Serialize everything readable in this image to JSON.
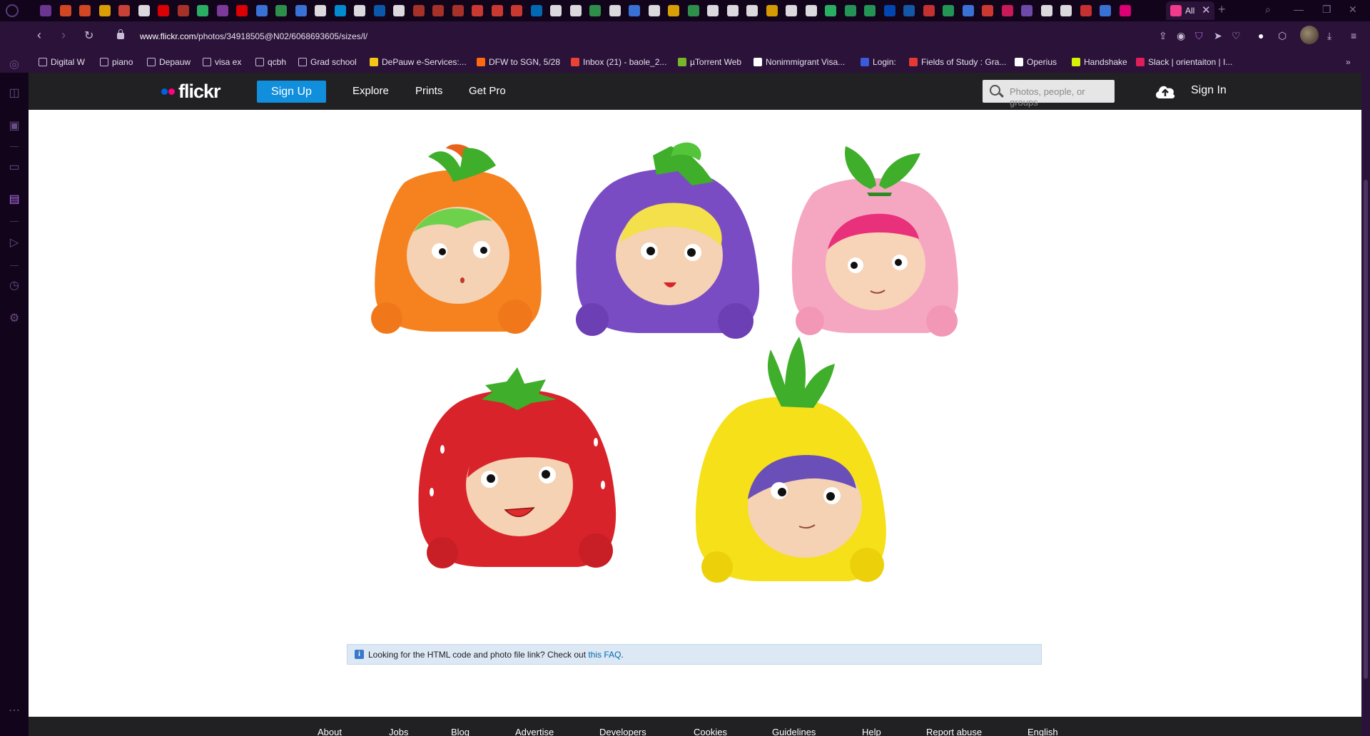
{
  "browser": {
    "active_tab_title": "All",
    "url_domain": "www.flickr.com",
    "url_path": "/photos/34918505@N02/6068693605/sizes/l/",
    "tab_icon_colors": [
      "#7a3fa3",
      "#f35325",
      "#f35325",
      "#ffb900",
      "#e74c3c",
      "#ffffff",
      "#ff0000",
      "#c0392b",
      "#2ecc71",
      "#8e44ad",
      "#ff0000",
      "#4285f4",
      "#34a853",
      "#4285f4",
      "#ffffff",
      "#00a4ef",
      "#ffffff",
      "#0a66c2",
      "#ffffff",
      "#c0392b",
      "#c0392b",
      "#c0392b",
      "#ea4335",
      "#ea4335",
      "#ea4335",
      "#007acc",
      "#ffffff",
      "#ffffff",
      "#34a853",
      "#ffffff",
      "#4285f4",
      "#ffffff",
      "#fbbc04",
      "#34a853",
      "#ffffff",
      "#ffffff",
      "#ffffff",
      "#f7b500",
      "#ffffff",
      "#ffffff",
      "#2ecc71",
      "#27ae60",
      "#27ae60",
      "#0052cc",
      "#1565c0",
      "#e53935",
      "#27ae60",
      "#4285f4",
      "#ea4335",
      "#e91e63",
      "#7e57c2",
      "#ffffff",
      "#ffffff",
      "#e53935",
      "#4285f4",
      "#ff0084"
    ]
  },
  "bookmarks": [
    {
      "label": "Digital W",
      "icon": "folder-icon"
    },
    {
      "label": "piano",
      "icon": "folder-icon"
    },
    {
      "label": "Depauw",
      "icon": "folder-icon"
    },
    {
      "label": "visa ex",
      "icon": "folder-icon"
    },
    {
      "label": "qcbh",
      "icon": "folder-icon"
    },
    {
      "label": "Grad school",
      "icon": "folder-icon"
    },
    {
      "label": "DePauw e-Services:...",
      "icon": "depauw-icon",
      "color": "#f5c518"
    },
    {
      "label": "DFW to SGN, 5/28",
      "icon": "kayak-icon",
      "color": "#ff690f"
    },
    {
      "label": "Inbox (21) - baole_2...",
      "icon": "gmail-icon",
      "color": "#ea4335"
    },
    {
      "label": "µTorrent Web",
      "icon": "utorrent-icon",
      "color": "#78b52b"
    },
    {
      "label": "Nonimmigrant Visa...",
      "icon": "visa-icon",
      "color": "#ffffff"
    },
    {
      "label": "Login:",
      "icon": "login-icon",
      "color": "#3b5bdb"
    },
    {
      "label": "Fields of Study : Gra...",
      "icon": "fields-icon",
      "color": "#e53935"
    },
    {
      "label": "Operius",
      "icon": "doc-icon",
      "color": "#ffffff"
    },
    {
      "label": "Handshake",
      "icon": "handshake-icon",
      "color": "#d7f205"
    },
    {
      "label": "Slack | orientaiton | I...",
      "icon": "slack-icon",
      "color": "#e01e5a"
    }
  ],
  "flickr": {
    "logo_text": "flickr",
    "signup_label": "Sign Up",
    "nav": [
      "Explore",
      "Prints",
      "Get Pro"
    ],
    "search_placeholder": "Photos, people, or groups",
    "signin_label": "Sign In",
    "faq_text": "Looking for the HTML code and photo file link? Check out ",
    "faq_link": "this FAQ",
    "footer_links": [
      "About",
      "Jobs",
      "Blog",
      "Advertise",
      "Developers",
      "Cookies",
      "Guidelines",
      "Help",
      "Report abuse",
      "English"
    ]
  },
  "photo": {
    "subject": "Five fruit-themed plush backpacks with cartoon faces",
    "items": [
      {
        "fruit": "orange",
        "color": "#f5821f",
        "hair": "#6ed14b"
      },
      {
        "fruit": "grape",
        "color": "#7a4cc4",
        "hair": "#f3e04a"
      },
      {
        "fruit": "peach",
        "color": "#f5a7c2",
        "hair": "#e8317a"
      },
      {
        "fruit": "strawberry",
        "color": "#d8232a",
        "hair": "#d8232a"
      },
      {
        "fruit": "pineapple",
        "color": "#f6e01a",
        "hair": "#6b4fb8"
      }
    ]
  }
}
